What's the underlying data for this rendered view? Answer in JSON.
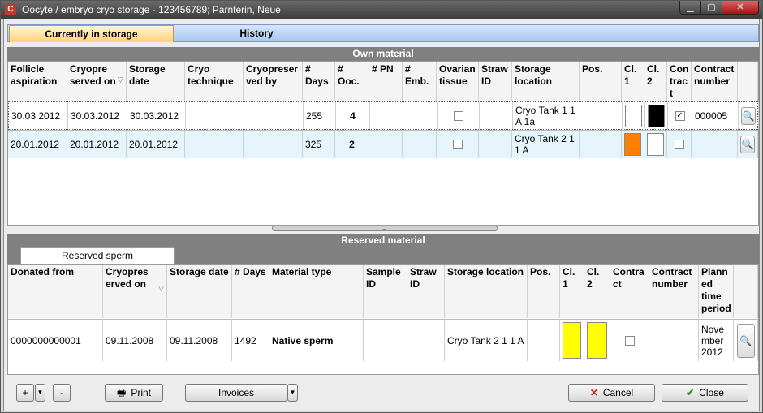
{
  "window": {
    "title": "Oocyte / embryo cryo storage - 123456789; Parnterin, Neue",
    "min": "▁",
    "max": "▢",
    "close": "✕",
    "app_icon": "C"
  },
  "tabs": [
    {
      "label": "Currently in storage"
    },
    {
      "label": "History"
    }
  ],
  "own": {
    "section_title": "Own material",
    "headers": [
      "Follicle aspiration",
      "Cryopre served on",
      "Storage date",
      "Cryo technique",
      "Cryopreser ved by",
      "# Days",
      "# Ooc.",
      "# PN",
      "# Emb.",
      "Ovarian tissue",
      "Straw ID",
      "Storage location",
      "Pos.",
      "Cl. 1",
      "Cl. 2",
      "Con trac t",
      "Contract number"
    ],
    "sort_icon": "▽",
    "rows": [
      {
        "c0": "30.03.2012",
        "c1": "30.03.2012",
        "c2": "30.03.2012",
        "days": "255",
        "ooc": "4",
        "loc": "Cryo Tank 1 1 A 1a",
        "cl1": "#ffffff",
        "cl2": "#000000",
        "contract": "✓",
        "contract_no": "000005"
      },
      {
        "c0": "20.01.2012",
        "c1": "20.01.2012",
        "c2": "20.01.2012",
        "days": "325",
        "ooc": "2",
        "loc": "Cryo Tank 2 1 1 A",
        "cl1": "#ff7f00",
        "cl2": "#ffffff",
        "contract": "",
        "contract_no": ""
      }
    ]
  },
  "reserved": {
    "section_title": "Reserved material",
    "subtab": "Reserved sperm",
    "headers": [
      "Donated from",
      "Cryopres erved on",
      "Storage date",
      "# Days",
      "Material type",
      "Sample ID",
      "Straw ID",
      "Storage location",
      "Pos.",
      "Cl. 1",
      "Cl. 2",
      "Contra ct",
      "Contract number",
      "Plann ed time period"
    ],
    "sort_icon": "▽",
    "rows": [
      {
        "donor": "0000000000001",
        "cryo": "09.11.2008",
        "storage": "09.11.2008",
        "days": "1492",
        "type": "Native sperm",
        "loc": "Cryo Tank 2 1 1 A",
        "cl1": "#ffff00",
        "cl2": "#ffff00",
        "period": "Nove mber 2012"
      }
    ]
  },
  "splitter_icon": "⌄",
  "row_action_icon": "🔍",
  "toolbar": {
    "plus": "+",
    "dropdown": "▼",
    "minus": "-",
    "print": "Print",
    "print_icon": "🖶",
    "invoices": "Invoices",
    "cancel": "Cancel",
    "cancel_icon": "✕",
    "close": "Close",
    "close_icon": "✔"
  },
  "colors": {
    "cancel_icon": "#cc2222",
    "close_icon": "#2a9a2a"
  }
}
